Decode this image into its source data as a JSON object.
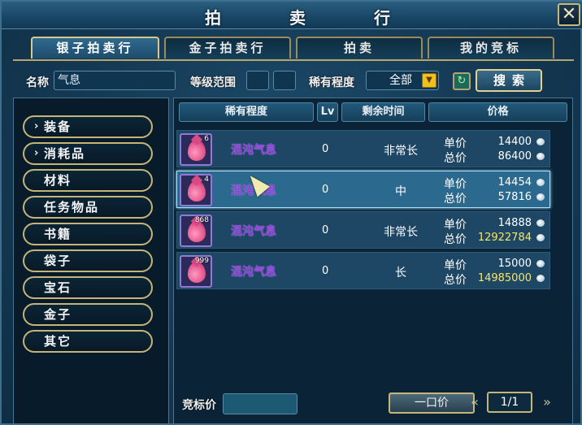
{
  "window": {
    "title_chars": [
      "拍",
      "卖",
      "行"
    ],
    "close_label": "✕"
  },
  "tabs": [
    {
      "label": "银子拍卖行",
      "active": true
    },
    {
      "label": "金子拍卖行",
      "active": false
    },
    {
      "label": "拍卖",
      "active": false
    },
    {
      "label": "我的竞标",
      "active": false
    }
  ],
  "filters": {
    "name_label": "名称",
    "name_value": "气息",
    "level_label": "等级范围",
    "level_min": "",
    "level_max": "",
    "rarity_label": "稀有程度",
    "rarity_value": "全部",
    "search_label": "搜索"
  },
  "categories": [
    {
      "label": "装备",
      "expandable": true
    },
    {
      "label": "消耗品",
      "expandable": true
    },
    {
      "label": "材料",
      "expandable": false
    },
    {
      "label": "任务物品",
      "expandable": false
    },
    {
      "label": "书籍",
      "expandable": false
    },
    {
      "label": "袋子",
      "expandable": false
    },
    {
      "label": "宝石",
      "expandable": false
    },
    {
      "label": "金子",
      "expandable": false
    },
    {
      "label": "其它",
      "expandable": false
    }
  ],
  "columns": {
    "rarity": "稀有程度",
    "lv": "Lv",
    "time": "剩余时间",
    "price": "价格"
  },
  "price_labels": {
    "unit": "单价",
    "total": "总价"
  },
  "listings": [
    {
      "qty": "6",
      "name": "混沌气息",
      "lv": "0",
      "time": "非常长",
      "unit_price": "14400",
      "total_price": "86400",
      "total_gold": false,
      "selected": false
    },
    {
      "qty": "4",
      "name": "混沌气息",
      "lv": "0",
      "time": "中",
      "unit_price": "14454",
      "total_price": "57816",
      "total_gold": false,
      "selected": true
    },
    {
      "qty": "868",
      "name": "混沌气息",
      "lv": "0",
      "time": "非常长",
      "unit_price": "14888",
      "total_price": "12922784",
      "total_gold": true,
      "selected": false
    },
    {
      "qty": "999",
      "name": "混沌气息",
      "lv": "0",
      "time": "长",
      "unit_price": "15000",
      "total_price": "14985000",
      "total_gold": true,
      "selected": false
    }
  ],
  "bottom": {
    "bid_label": "竞标价",
    "bid_value": "",
    "buyout_label": "一口价",
    "page": "1/1"
  },
  "colors": {
    "item_name": "#8a3fd6",
    "gold_price": "#f5e66a",
    "frame_gold": "#c5b47a"
  }
}
